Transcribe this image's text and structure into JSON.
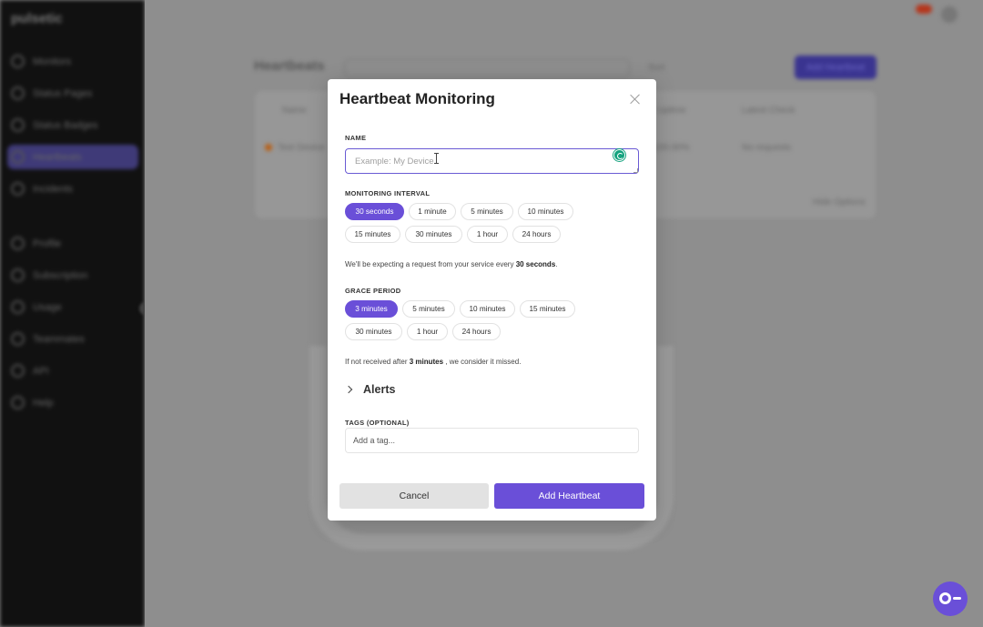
{
  "background": {
    "logo": "pulsetic",
    "nav_top": [
      "Monitors",
      "Status Pages",
      "Status Badges",
      "Heartbeats",
      "Incidents"
    ],
    "nav_bottom": [
      "Profile",
      "Subscription",
      "Usage",
      "Teammates",
      "API",
      "Help"
    ],
    "page_title": "Heartbeats",
    "sort_label": "Sort",
    "add_button": "Add Heartbeat",
    "columns": [
      "Name",
      "Uptime",
      "Latest Check"
    ],
    "row_name": "Test Device",
    "row_uptime": "100.00%",
    "row_status": "No requests",
    "hide_options": "Hide Options"
  },
  "modal": {
    "title": "Heartbeat Monitoring",
    "name_label": "NAME",
    "name_placeholder": "Example: My Device",
    "interval_label": "MONITORING INTERVAL",
    "interval_options": [
      "30 seconds",
      "1 minute",
      "5 minutes",
      "10 minutes",
      "15 minutes",
      "30 minutes",
      "1 hour",
      "24 hours"
    ],
    "interval_selected": "30 seconds",
    "interval_hint_prefix": "We'll be expecting a request from your service every ",
    "interval_hint_value": "30 seconds",
    "interval_hint_suffix": ".",
    "grace_label": "GRACE PERIOD",
    "grace_options": [
      "3 minutes",
      "5 minutes",
      "10 minutes",
      "15 minutes",
      "30 minutes",
      "1 hour",
      "24 hours"
    ],
    "grace_selected": "3 minutes",
    "grace_hint_prefix": "If not received after ",
    "grace_hint_value": "3 minutes",
    "grace_hint_suffix": " , we consider it missed.",
    "alerts_label": "Alerts",
    "tags_label": "TAGS (OPTIONAL)",
    "tags_placeholder": "Add a tag...",
    "cancel_label": "Cancel",
    "submit_label": "Add Heartbeat"
  },
  "colors": {
    "accent": "#6a4fd8",
    "overlay": "#8d8d8d"
  }
}
